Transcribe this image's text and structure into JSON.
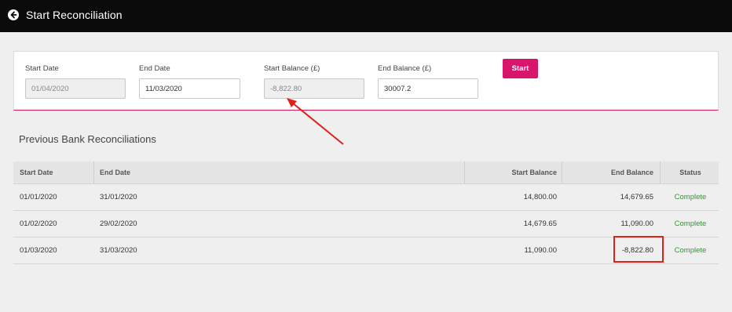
{
  "header": {
    "title": "Start Reconciliation",
    "back_icon": "arrow-left-circle-icon"
  },
  "form": {
    "start_date": {
      "label": "Start Date",
      "value": "01/04/2020",
      "disabled": true
    },
    "end_date": {
      "label": "End Date",
      "value": "11/03/2020"
    },
    "start_balance": {
      "label": "Start Balance (£)",
      "value": "-8,822.80",
      "disabled": true
    },
    "end_balance": {
      "label": "End Balance (£)",
      "value": "30007.2"
    },
    "start_button": "Start"
  },
  "previous": {
    "title": "Previous Bank Reconciliations",
    "columns": {
      "start_date": "Start Date",
      "end_date": "End Date",
      "start_balance": "Start Balance",
      "end_balance": "End Balance",
      "status": "Status"
    },
    "rows": [
      {
        "start_date": "01/01/2020",
        "end_date": "31/01/2020",
        "start_balance": "14,800.00",
        "end_balance": "14,679.65",
        "status": "Complete"
      },
      {
        "start_date": "01/02/2020",
        "end_date": "29/02/2020",
        "start_balance": "14,679.65",
        "end_balance": "11,090.00",
        "status": "Complete"
      },
      {
        "start_date": "01/03/2020",
        "end_date": "31/03/2020",
        "start_balance": "11,090.00",
        "end_balance": "-8,822.80",
        "status": "Complete"
      }
    ]
  },
  "colors": {
    "header_bg": "#0b0b0b",
    "accent": "#d8146b",
    "status_complete": "#2e9a2e",
    "annotation": "#e0201b"
  }
}
